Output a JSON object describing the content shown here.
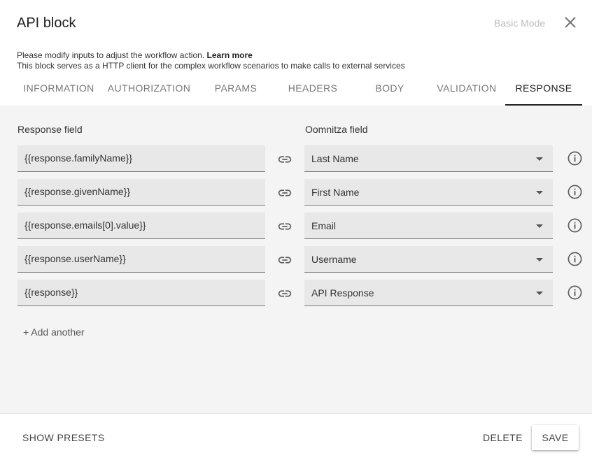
{
  "header": {
    "title": "API block",
    "basic_mode_label": "Basic Mode",
    "close_icon": "close-icon"
  },
  "description": {
    "line1": "Please modify inputs to adjust the workflow action.",
    "learn_more": "Learn more",
    "line2": "This block serves as a HTTP client for the complex workflow scenarios to make calls to external services"
  },
  "tabs": [
    {
      "label": "INFORMATION",
      "active": false
    },
    {
      "label": "AUTHORIZATION",
      "active": false
    },
    {
      "label": "PARAMS",
      "active": false
    },
    {
      "label": "HEADERS",
      "active": false
    },
    {
      "label": "BODY",
      "active": false
    },
    {
      "label": "VALIDATION",
      "active": false
    },
    {
      "label": "RESPONSE",
      "active": true
    }
  ],
  "response": {
    "response_field_label": "Response field",
    "oomnitza_field_label": "Oomnitza field",
    "rows": [
      {
        "response_field": "{{response.familyName}}",
        "oomnitza_field": "Last Name"
      },
      {
        "response_field": "{{response.givenName}}",
        "oomnitza_field": "First Name"
      },
      {
        "response_field": "{{response.emails[0].value}}",
        "oomnitza_field": "Email"
      },
      {
        "response_field": "{{response.userName}}",
        "oomnitza_field": "Username"
      },
      {
        "response_field": "{{response}}",
        "oomnitza_field": "API Response"
      }
    ],
    "add_another_label": "+ Add another"
  },
  "footer": {
    "show_presets_label": "SHOW PRESETS",
    "delete_label": "DELETE",
    "save_label": "SAVE"
  },
  "colors": {
    "content_bg": "#f4f4f4",
    "field_bg": "#e8e8e8",
    "active_tab": "#212121",
    "muted_text": "#bdbdbd"
  }
}
